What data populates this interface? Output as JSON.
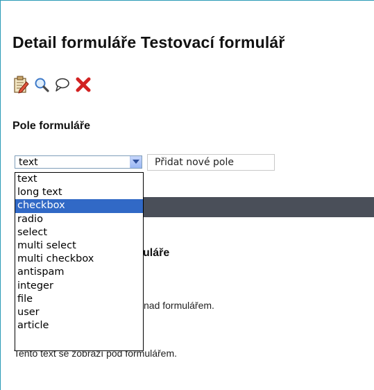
{
  "page": {
    "title": "Detail formuláře Testovací formulář"
  },
  "toolbar": {
    "icons": [
      "edit-icon",
      "search-icon",
      "comment-icon",
      "delete-icon"
    ]
  },
  "fields_section": {
    "title": "Pole formuláře",
    "select": {
      "current_value": "text",
      "options": [
        "text",
        "long text",
        "checkbox",
        "radio",
        "select",
        "multi select",
        "multi checkbox",
        "antispam",
        "integer",
        "file",
        "user",
        "article"
      ],
      "highlighted_option": "checkbox"
    },
    "add_button_label": "Přidat nové pole"
  },
  "texts_section": {
    "title_visible": "uláře",
    "text_above_visible": "nad formulářem.",
    "text_below_visible": "Tento text se zobrazí pod formulářem."
  },
  "colors": {
    "accent_border": "#2a9bb6",
    "dark_bar": "#4a4f59",
    "selection": "#3169c6"
  }
}
